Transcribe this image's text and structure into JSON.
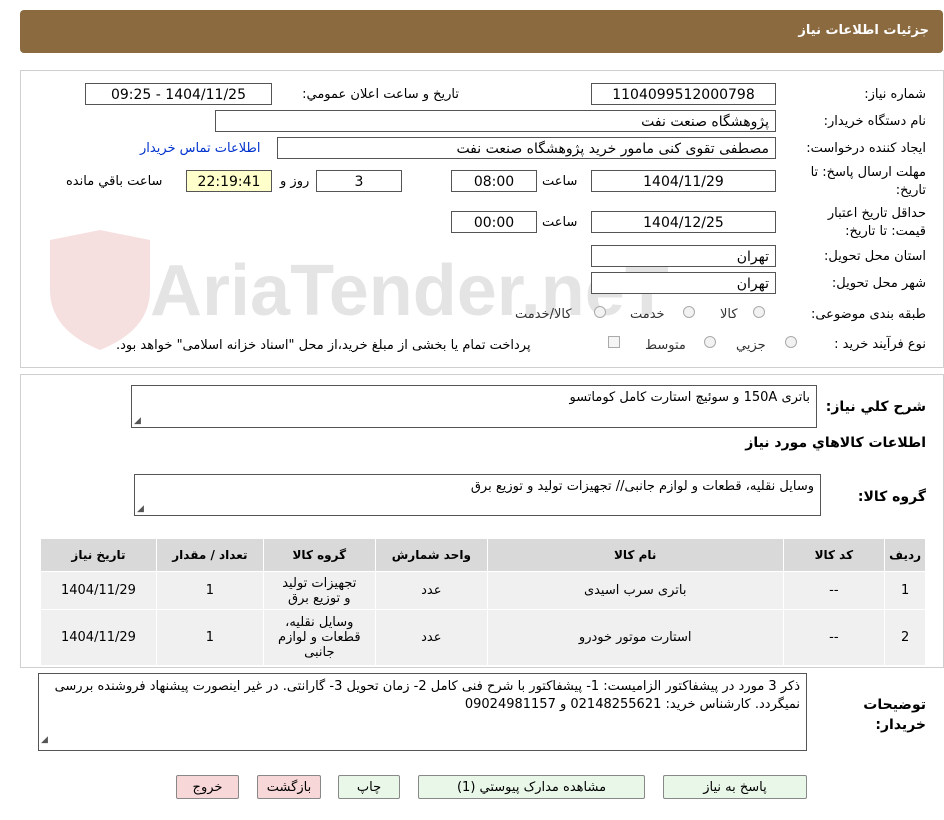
{
  "header": {
    "title": "جزئیات اطلاعات نیاز"
  },
  "watermark": {
    "text": "AriaTender.neT"
  },
  "info": {
    "need_number_label": "شماره نیاز:",
    "need_number": "1104099512000798",
    "announce_label": "تاریخ و ساعت اعلان عمومي:",
    "announce_value": "1404/11/25 - 09:25",
    "buyer_org_label": "نام دستگاه خريدار:",
    "buyer_org": "پژوهشگاه صنعت نفت",
    "requester_label": "ایجاد کننده درخواست:",
    "requester": "مصطفی تقوی کنی مامور خرید پژوهشگاه صنعت نفت",
    "contact_link": "اطلاعات تماس خريدار",
    "deadline_label": "مهلت ارسال پاسخ: تا تاریخ:",
    "deadline_date": "1404/11/29",
    "time_label": "ساعت",
    "deadline_time": "08:00",
    "days_value": "3",
    "days_label": "روز و",
    "remaining_time": "22:19:41",
    "remaining_label": "ساعت باقي مانده",
    "validity_label": "حداقل تاریخ اعتبار قیمت: تا تاریخ:",
    "validity_date": "1404/12/25",
    "validity_time": "00:00",
    "province_label": "استان محل تحویل:",
    "province": "تهران",
    "city_label": "شهر محل تحویل:",
    "city": "تهران",
    "category_label": "طبقه بندی موضوعی:",
    "category_options": [
      "کالا",
      "خدمت",
      "کالا/خدمت"
    ],
    "process_label": "نوع فرآیند خرید :",
    "process_options": [
      "جزیي",
      "متوسط"
    ],
    "payment_note": "پرداخت تمام یا بخشی از مبلغ خرید،از محل \"اسناد خزانه اسلامی\" خواهد بود."
  },
  "description": {
    "label": "شرح کلي نیاز:",
    "value": "باتری 150A و سوئیچ استارت کامل کوماتسو",
    "goods_info_title": "اطلاعات کالاهاي مورد نیاز",
    "goods_group_label": "گروه کالا:",
    "goods_group_value": "وسایل نقلیه، قطعات و لوازم جانبی// تجهیزات تولید و توزیع برق"
  },
  "table": {
    "headers": [
      "ردیف",
      "کد کالا",
      "نام کالا",
      "واحد شمارش",
      "گروه کالا",
      "تعداد / مقدار",
      "تاریخ نیاز"
    ],
    "rows": [
      {
        "row": "1",
        "code": "--",
        "name": "باتری سرب اسیدی",
        "unit": "عدد",
        "group": "تجهیزات تولید و توزیع برق",
        "qty": "1",
        "date": "1404/11/29"
      },
      {
        "row": "2",
        "code": "--",
        "name": "استارت موتور خودرو",
        "unit": "عدد",
        "group": "وسایل نقلیه، قطعات و لوازم جانبی",
        "qty": "1",
        "date": "1404/11/29"
      }
    ]
  },
  "buyer_notes": {
    "label": "توضیحات خریدار:",
    "value": "ذکر 3 مورد در پیشفاکتور الزامیست: 1- پیشفاکتور با شرح فنی کامل 2- زمان تحویل 3- گارانتی. در غیر اینصورت پیشنهاد فروشنده بررسی نمیگردد. کارشناس خرید: 02148255621 و 09024981157"
  },
  "buttons": {
    "reply": "پاسخ به نیاز",
    "attachments": "مشاهده مدارک پیوستي (1)",
    "print": "چاپ",
    "back": "بازگشت",
    "exit": "خروج"
  }
}
